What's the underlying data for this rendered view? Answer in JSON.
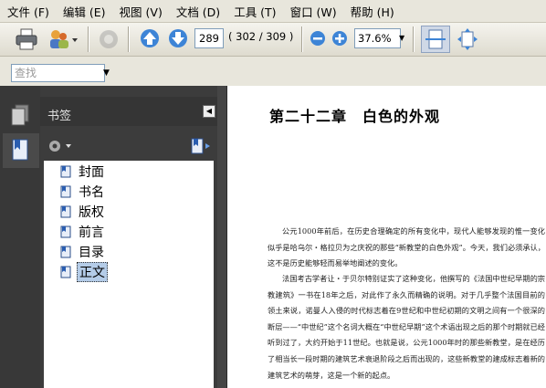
{
  "menubar": {
    "items": [
      "文件 (F)",
      "编辑 (E)",
      "视图 (V)",
      "文档 (D)",
      "工具 (T)",
      "窗口 (W)",
      "帮助 (H)"
    ]
  },
  "toolbar": {
    "page_current": "289",
    "page_count": "( 302 / 309 )",
    "zoom": "37.6%"
  },
  "find": {
    "placeholder": "查找"
  },
  "panel": {
    "title": "书签",
    "bookmarks": [
      "封面",
      "书名",
      "版权",
      "前言",
      "目录",
      "正文"
    ],
    "selected_index": 5
  },
  "document": {
    "chapter_title": "第二十二章　白色的外观",
    "paragraph1": "公元1000年前后，在历史合理确定的所有变化中，现代人能够发现的惟一变化似乎是哈乌尔・格拉贝为之庆祝的那些“新教堂的白色外观”。今天，我们必须承认，这不是历史能够轻而易举地阐述的变化。",
    "paragraph2": "法国考古学者让・于贝尔特别证实了这种变化，他撰写的《法国中世纪早期的宗教建筑》一书在18年之后，对此作了永久而精确的说明。对于几乎整个法国目前的领土来说，诺曼人入侵的时代标志着在9世纪和中世纪初期的文明之间有一个很深的断层——“中世纪”这个名词大概在“中世纪早期”这个术语出现之后的那个时期就已经听到过了，大约开始于11世纪。也就是说，公元1000年时的那些新教堂，是在经历了相当长一段时期的建筑艺术衰退阶段之后而出现的，这些新教堂的建成标志着新的建筑艺术的萌芽，这是一个新的起点。"
  },
  "colors": {
    "menubar_bg": "#e8e6dc",
    "panel_bg": "#3c3c3c",
    "selection": "#b4cce8"
  }
}
